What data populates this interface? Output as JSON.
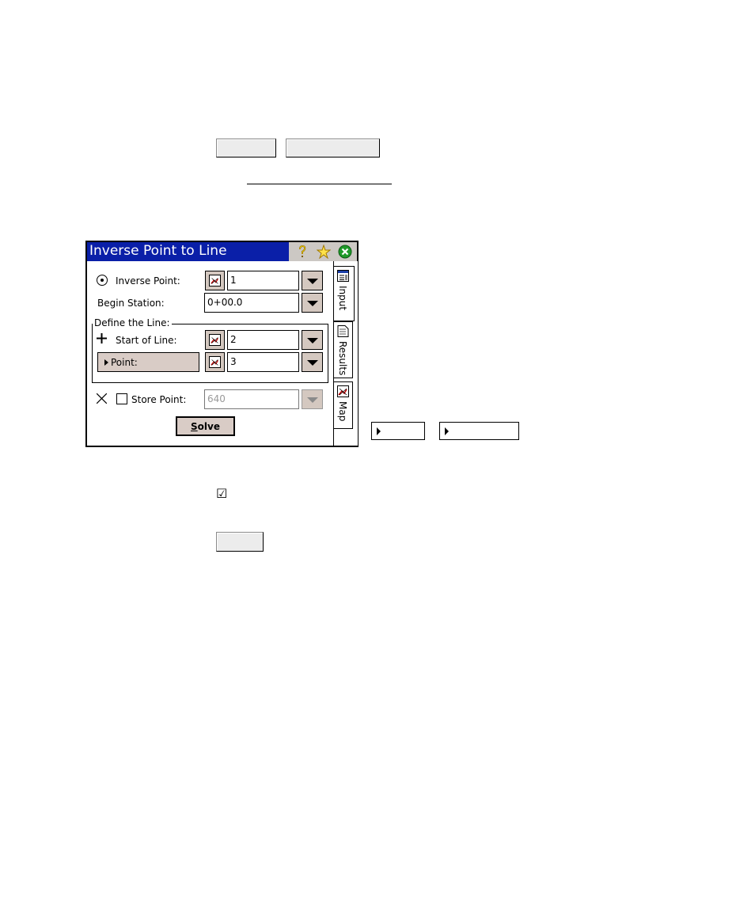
{
  "window": {
    "title": "Inverse Point to Line",
    "title_icons": [
      "help-icon",
      "favorite-star-icon",
      "close-icon"
    ]
  },
  "form": {
    "inverse_point": {
      "label": "Inverse Point:",
      "value": "1"
    },
    "begin_station": {
      "label": "Begin Station:",
      "value": "0+00.0"
    },
    "define_line": {
      "title": "Define the Line:",
      "start_of_line": {
        "label": "Start of Line:",
        "value": "2"
      },
      "point": {
        "label": "Point:",
        "value": "3"
      }
    },
    "store_point": {
      "label": "Store Point:",
      "value": "640",
      "checked": false
    },
    "solve_label": "Solve"
  },
  "tabs": [
    {
      "label": "Input",
      "icon": "input-tab-icon",
      "active": true
    },
    {
      "label": "Results",
      "icon": "results-tab-icon",
      "active": false
    },
    {
      "label": "Map",
      "icon": "map-tab-icon",
      "active": false
    }
  ],
  "document": {
    "checkbox_glyph": "☑"
  },
  "colors": {
    "titlebar": "#0a1fa8",
    "button_face": "#d9ccc6"
  }
}
